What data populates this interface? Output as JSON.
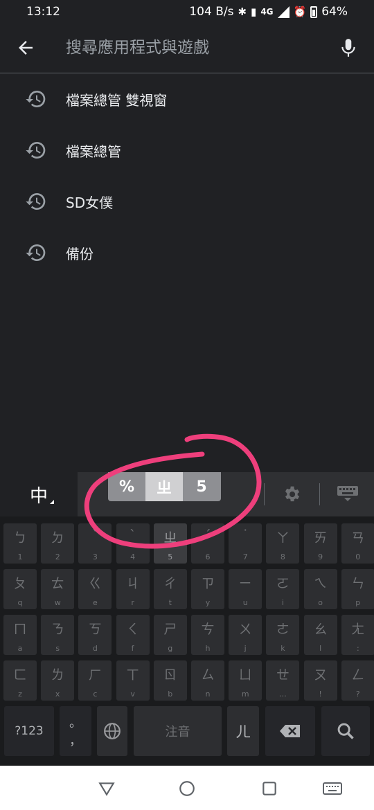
{
  "status": {
    "time": "13:12",
    "net_speed": "104 B/s",
    "network": "4G",
    "battery": "64%"
  },
  "search": {
    "placeholder": "搜尋應用程式與遊戲"
  },
  "history": [
    {
      "label": "檔案總管 雙視窗"
    },
    {
      "label": "檔案總管"
    },
    {
      "label": "SD女僕"
    },
    {
      "label": "備份"
    }
  ],
  "keyboard": {
    "lang_label": "中",
    "popup": [
      "%",
      "ㄓ",
      "5"
    ],
    "popup_selected_index": 1,
    "rows": [
      [
        {
          "main": "ㄅ",
          "sub": "1"
        },
        {
          "main": "ㄉ",
          "sub": "2"
        },
        {
          "main": "ˇ",
          "sub": "3"
        },
        {
          "main": "ˋ",
          "sub": "4"
        },
        {
          "main": "ㄓ",
          "sub": "5"
        },
        {
          "main": "ˊ",
          "sub": "6"
        },
        {
          "main": "˙",
          "sub": "7"
        },
        {
          "main": "ㄚ",
          "sub": "8"
        },
        {
          "main": "ㄞ",
          "sub": "9"
        },
        {
          "main": "ㄢ",
          "sub": "0"
        }
      ],
      [
        {
          "main": "ㄆ",
          "sub": "q"
        },
        {
          "main": "ㄊ",
          "sub": "w"
        },
        {
          "main": "ㄍ",
          "sub": "e"
        },
        {
          "main": "ㄐ",
          "sub": "r"
        },
        {
          "main": "ㄔ",
          "sub": "t"
        },
        {
          "main": "ㄗ",
          "sub": "y"
        },
        {
          "main": "ㄧ",
          "sub": "u"
        },
        {
          "main": "ㄛ",
          "sub": "i"
        },
        {
          "main": "ㄟ",
          "sub": "o"
        },
        {
          "main": "ㄣ",
          "sub": "p"
        }
      ],
      [
        {
          "main": "ㄇ",
          "sub": "a"
        },
        {
          "main": "ㄋ",
          "sub": "s"
        },
        {
          "main": "ㄎ",
          "sub": "d"
        },
        {
          "main": "ㄑ",
          "sub": "f"
        },
        {
          "main": "ㄕ",
          "sub": "g"
        },
        {
          "main": "ㄘ",
          "sub": "h"
        },
        {
          "main": "ㄨ",
          "sub": "j"
        },
        {
          "main": "ㄜ",
          "sub": "k"
        },
        {
          "main": "ㄠ",
          "sub": "l"
        },
        {
          "main": "ㄤ",
          "sub": ":"
        }
      ],
      [
        {
          "main": "ㄈ",
          "sub": "z"
        },
        {
          "main": "ㄌ",
          "sub": "x"
        },
        {
          "main": "ㄏ",
          "sub": "c"
        },
        {
          "main": "ㄒ",
          "sub": "v"
        },
        {
          "main": "ㄖ",
          "sub": "b"
        },
        {
          "main": "ㄙ",
          "sub": "n"
        },
        {
          "main": "ㄩ",
          "sub": "m"
        },
        {
          "main": "ㄝ",
          "sub": "…"
        },
        {
          "main": "ㄡ",
          "sub": "!"
        },
        {
          "main": "ㄥ",
          "sub": "?"
        }
      ]
    ],
    "highlight_key": "ㄓ",
    "symbols_label": "?123",
    "comma_label": "，",
    "period_label": "。",
    "space_label": "注音",
    "er_label": "ㄦ"
  },
  "colors": {
    "background": "#202124",
    "annotation": "#ee3f7c"
  },
  "icons": {
    "back": "arrow-back-icon",
    "mic": "microphone-icon",
    "history": "history-icon",
    "gear": "gear-icon",
    "hide_keyboard": "keyboard-hide-icon",
    "globe": "globe-icon",
    "backspace": "backspace-icon",
    "search": "search-icon"
  }
}
